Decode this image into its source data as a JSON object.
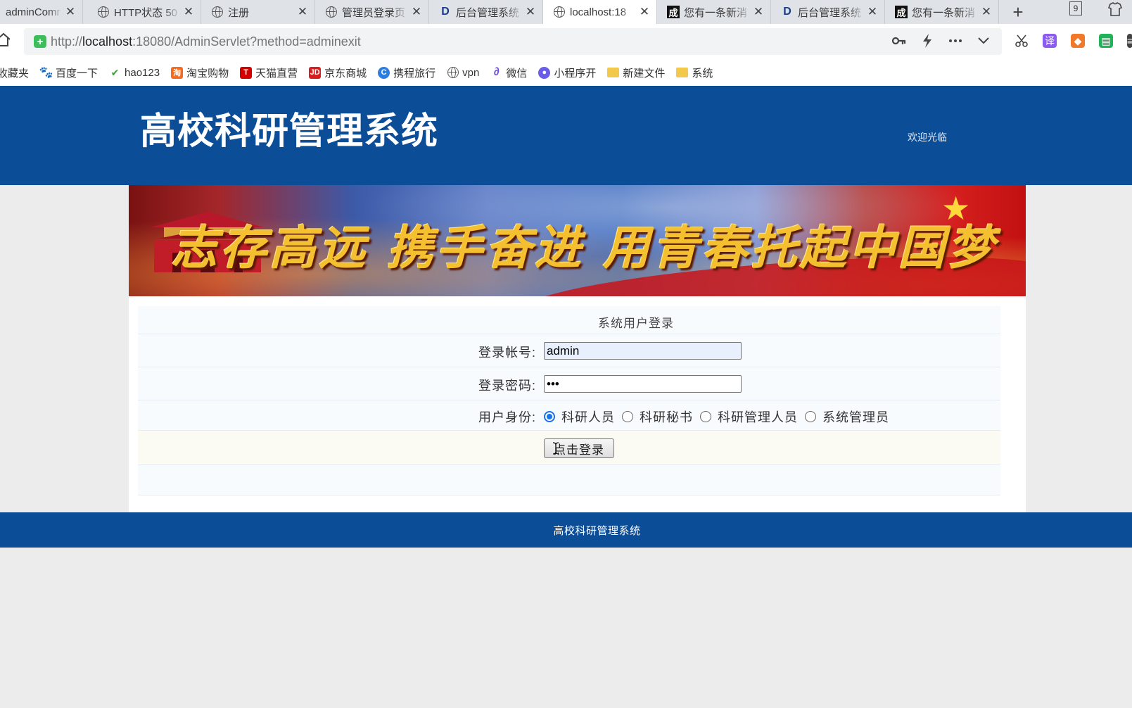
{
  "browser": {
    "tabs": [
      {
        "label": "adminComr",
        "icon": "none",
        "active": false
      },
      {
        "label": "HTTP状态 50",
        "icon": "globe-icon",
        "active": false
      },
      {
        "label": "注册",
        "icon": "globe-icon",
        "active": false
      },
      {
        "label": "管理员登录页",
        "icon": "globe-icon",
        "active": false
      },
      {
        "label": "后台管理系统",
        "icon": "d-logo-icon",
        "active": false
      },
      {
        "label": "localhost:18",
        "icon": "globe-icon",
        "active": true
      },
      {
        "label": "您有一条新消",
        "icon": "cheng-icon",
        "active": false
      },
      {
        "label": "后台管理系统",
        "icon": "d-logo-icon",
        "active": false
      },
      {
        "label": "您有一条新消",
        "icon": "cheng-icon",
        "active": false
      }
    ],
    "tab_close_glyph": "✕",
    "new_tab_glyph": "+",
    "window_badge": "9",
    "url_prefix": "http://",
    "url_host": "localhost",
    "url_rest": ":18080/AdminServlet?method=adminexit",
    "bookmarks": [
      {
        "label": "收藏夹",
        "icon": "none"
      },
      {
        "label": "百度一下",
        "icon": "paw-icon"
      },
      {
        "label": "hao123",
        "icon": "hao-icon"
      },
      {
        "label": "淘宝购物",
        "icon": "taobao-icon"
      },
      {
        "label": "天猫直营",
        "icon": "tmall-icon"
      },
      {
        "label": "京东商城",
        "icon": "jd-icon"
      },
      {
        "label": "携程旅行",
        "icon": "ctrip-icon"
      },
      {
        "label": "vpn",
        "icon": "globe-icon"
      },
      {
        "label": "微信",
        "icon": "wechat-link-icon"
      },
      {
        "label": "小程序开",
        "icon": "miniprogram-icon"
      },
      {
        "label": "新建文件",
        "icon": "folder-icon"
      },
      {
        "label": "系统",
        "icon": "folder-icon"
      }
    ]
  },
  "header": {
    "site_title": "高校科研管理系统",
    "welcome": "欢迎光临"
  },
  "banner": {
    "slogan": "志存高远 携手奋进 用青春托起中国梦"
  },
  "login_form": {
    "title": "系统用户登录",
    "account_label": "登录帐号:",
    "account_value": "admin",
    "password_label": "登录密码:",
    "password_value": "•••",
    "role_label": "用户身份:",
    "roles": [
      {
        "label": "科研人员",
        "checked": true
      },
      {
        "label": "科研秘书",
        "checked": false
      },
      {
        "label": "科研管理人员",
        "checked": false
      },
      {
        "label": "系统管理员",
        "checked": false
      }
    ],
    "submit_label": "点击登录"
  },
  "footer": {
    "text": "高校科研管理系统"
  },
  "colors": {
    "header_bg": "#0c4d97",
    "page_bg": "#ececec",
    "radio_checked": "#1a73e8"
  }
}
